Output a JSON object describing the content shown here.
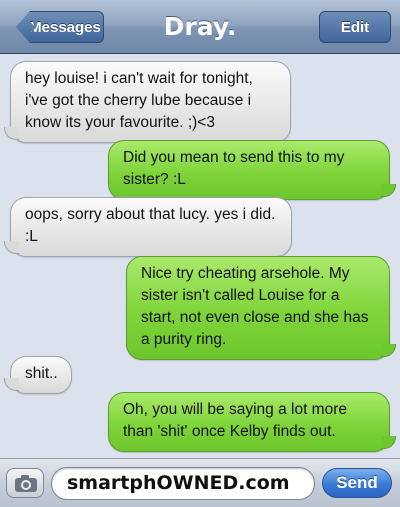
{
  "header": {
    "back_label": "Messages",
    "title": "Dray.",
    "edit_label": "Edit"
  },
  "messages": [
    {
      "direction": "incoming",
      "text": "hey louise! i can't wait for tonight, i've got the cherry lube because i know its your favourite. ;)<3"
    },
    {
      "direction": "outgoing",
      "text": "Did you mean to send this to my sister? :L"
    },
    {
      "direction": "incoming",
      "text": "oops, sorry about that lucy. yes i did. :L"
    },
    {
      "direction": "outgoing",
      "text": "Nice try cheating arsehole. My sister isn't called Louise for a start, not even close and she has a purity ring."
    },
    {
      "direction": "incoming",
      "text": "shit.."
    },
    {
      "direction": "outgoing",
      "text": "Oh, you will be saying a lot more than 'shit' once Kelby finds out."
    }
  ],
  "input": {
    "value": "smartphOWNED.com",
    "send_label": "Send",
    "camera_icon": "camera-icon"
  },
  "colors": {
    "outgoing_bubble": "#7fd43a",
    "incoming_bubble": "#e6e6e6",
    "send_button": "#3a7bd5",
    "background": "#dbe2ed"
  }
}
